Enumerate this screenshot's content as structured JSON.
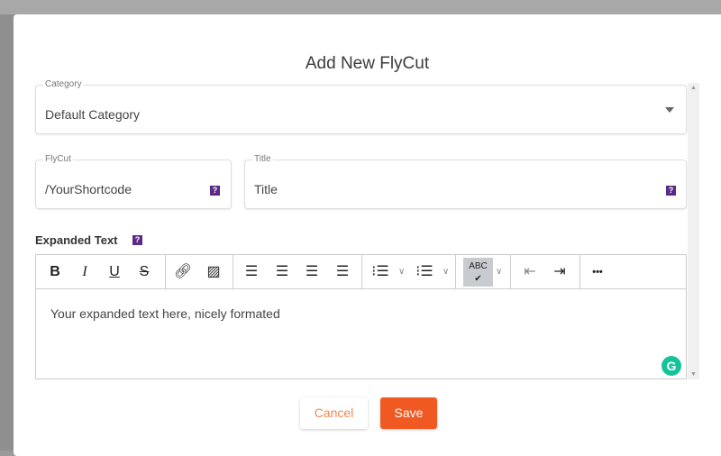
{
  "dialog": {
    "title": "Add New FlyCut"
  },
  "category": {
    "label": "Category",
    "value": "Default Category"
  },
  "flycut": {
    "label": "FlyCut",
    "value": "/YourShortcode",
    "help": "?"
  },
  "title_field": {
    "label": "Title",
    "value": "Title",
    "help": "?"
  },
  "expanded": {
    "label": "Expanded Text",
    "help": "?",
    "content": "Your expanded text here, nicely formated"
  },
  "toolbar": {
    "bold": "B",
    "italic": "I",
    "underline": "U",
    "strike": "S",
    "more": "•••"
  },
  "grammarly": "G",
  "buttons": {
    "cancel": "Cancel",
    "save": "Save"
  },
  "colors": {
    "accent": "#f05a22",
    "help": "#5b2a86"
  }
}
